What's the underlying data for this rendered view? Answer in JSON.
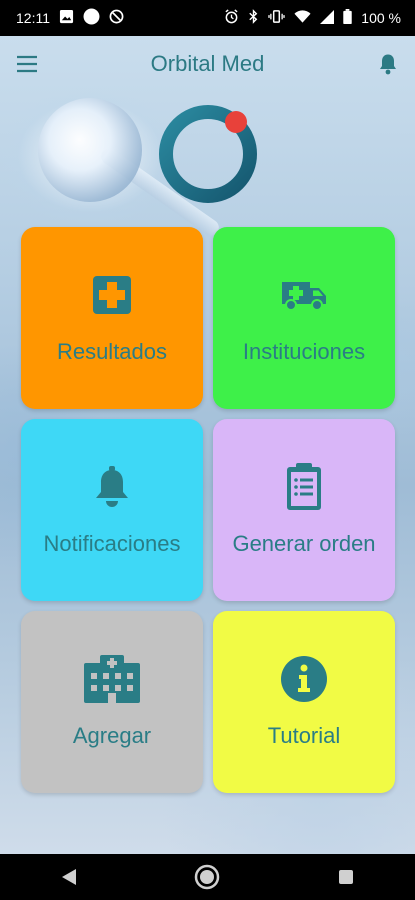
{
  "status_bar": {
    "time": "12:11",
    "battery": "100 %",
    "left_icons": [
      "image-icon",
      "circle-icon",
      "no-data-icon"
    ],
    "right_icons": [
      "alarm-icon",
      "bluetooth-icon",
      "vibrate-icon",
      "wifi-icon",
      "signal-icon",
      "battery-icon"
    ]
  },
  "app_bar": {
    "title": "Orbital Med",
    "menu_icon": "menu-icon",
    "notifications_icon": "bell-icon"
  },
  "tiles": [
    {
      "label": "Resultados",
      "color": "#ff9600",
      "icon": "medical-cross-icon"
    },
    {
      "label": "Instituciones",
      "color": "#3ef049",
      "icon": "ambulance-icon"
    },
    {
      "label": "Notificaciones",
      "color": "#3ed8f6",
      "icon": "bell-icon"
    },
    {
      "label": "Generar orden",
      "color": "#d9b6f8",
      "icon": "clipboard-icon"
    },
    {
      "label": "Agregar",
      "color": "#c2c2c2",
      "icon": "hospital-icon"
    },
    {
      "label": "Tutorial",
      "color": "#f1fb45",
      "icon": "info-icon"
    }
  ],
  "colors": {
    "accent": "#2a7d86",
    "logo_ring": "#1f6f84",
    "logo_dot": "#e8413a"
  },
  "nav_bar": {
    "icons": [
      "back-icon",
      "home-icon",
      "recents-icon"
    ]
  }
}
